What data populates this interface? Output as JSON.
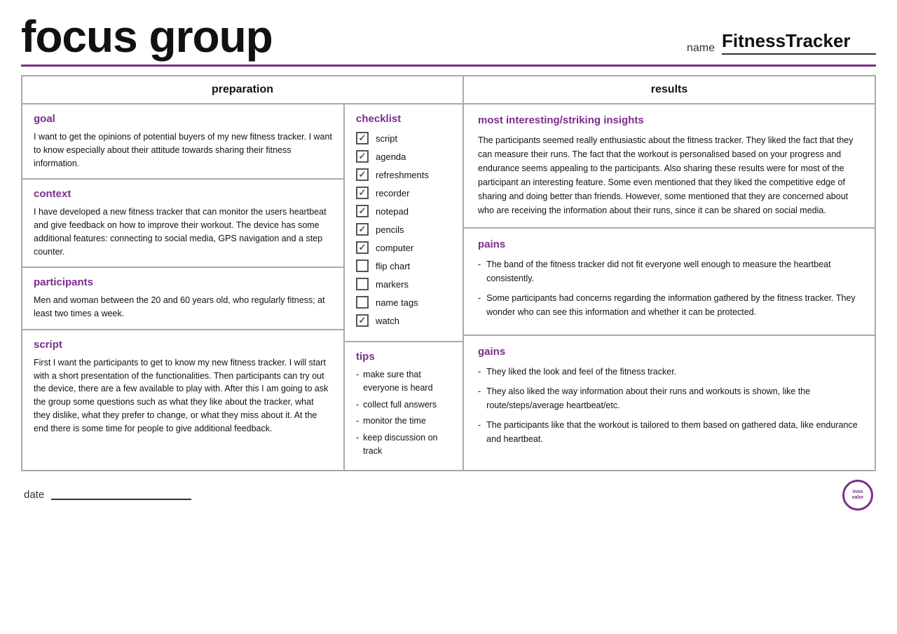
{
  "header": {
    "title": "focus group",
    "name_label": "name",
    "name_value": "FitnessTracker"
  },
  "preparation": {
    "section_label": "preparation",
    "goal": {
      "heading": "goal",
      "text": "I want to get the opinions of potential buyers of my new fitness tracker. I want to know especially about their attitude towards sharing their fitness information."
    },
    "context": {
      "heading": "context",
      "text": "I have developed a new fitness tracker that can monitor the users heartbeat and give feedback on how to improve their workout. The device has some additional features: connecting to social media, GPS navigation and a step counter."
    },
    "participants": {
      "heading": "participants",
      "text": "Men and woman between the 20 and 60 years old, who regularly fitness; at least two times a week."
    },
    "script": {
      "heading": "script",
      "text": "First I want the participants to get to know my new fitness tracker. I will start with a short presentation of the functionalities. Then participants can try out the device, there are a few available to play with. After this I am going to ask the group some questions such as what they like about the tracker, what they dislike, what they prefer to change, or what they miss about it. At the end there is some time for people to give additional feedback."
    },
    "checklist": {
      "heading": "checklist",
      "items": [
        {
          "label": "script",
          "checked": true
        },
        {
          "label": "agenda",
          "checked": true
        },
        {
          "label": "refreshments",
          "checked": true
        },
        {
          "label": "recorder",
          "checked": true
        },
        {
          "label": "notepad",
          "checked": true
        },
        {
          "label": "pencils",
          "checked": true
        },
        {
          "label": "computer",
          "checked": true
        },
        {
          "label": "flip chart",
          "checked": false
        },
        {
          "label": "markers",
          "checked": false
        },
        {
          "label": "name tags",
          "checked": false
        },
        {
          "label": "watch",
          "checked": true
        }
      ]
    },
    "tips": {
      "heading": "tips",
      "items": [
        "make sure that everyone is heard",
        "collect full answers",
        "monitor the time",
        "keep discussion on track"
      ]
    }
  },
  "results": {
    "section_label": "results",
    "insights": {
      "heading": "most interesting/striking insights",
      "text": "The participants seemed really enthusiastic about the fitness tracker. They liked the fact that they can measure their runs. The fact that the workout is personalised based on your progress and endurance seems appealing to the participants. Also sharing these results were for most of the participant an interesting feature. Some even mentioned that they liked the competitive edge of sharing and doing better than friends. However, some mentioned that they are concerned about who are receiving the information about their runs, since it can be shared on social media."
    },
    "pains": {
      "heading": "pains",
      "items": [
        "The band of the fitness tracker did not fit everyone well enough to measure the heartbeat consistently.",
        "Some participants had concerns regarding the information gathered by the fitness tracker. They wonder who can see this information and whether it can be protected."
      ]
    },
    "gains": {
      "heading": "gains",
      "items": [
        "They liked the look and feel of the fitness tracker.",
        "They also liked the way information about their runs and workouts is shown, like the route/steps/average heartbeat/etc.",
        "The participants like that the workout is tailored to them based on gathered data, like endurance and heartbeat."
      ]
    }
  },
  "footer": {
    "date_label": "date",
    "logo_top": "inno",
    "logo_bottom": "valor"
  }
}
